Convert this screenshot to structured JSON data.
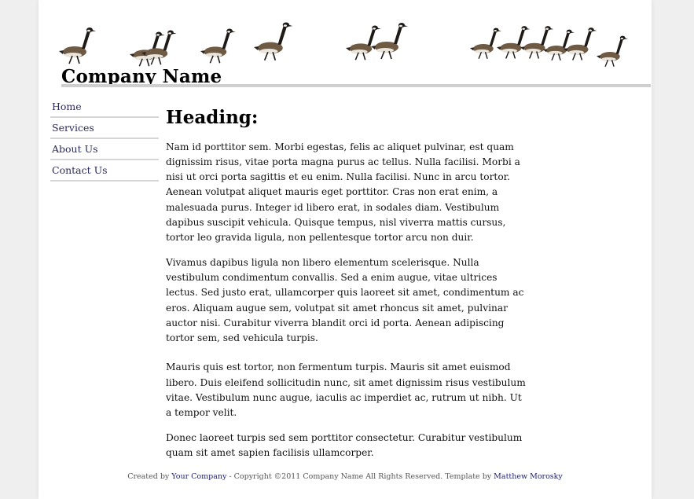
{
  "header": {
    "company_name": "Company Name",
    "banner_image": "canada-geese-walking-row"
  },
  "nav": {
    "items": [
      {
        "label": "Home"
      },
      {
        "label": "Services"
      },
      {
        "label": "About Us"
      },
      {
        "label": "Contact Us"
      }
    ]
  },
  "main": {
    "heading": "Heading:",
    "paragraphs": [
      "Nam id porttitor sem. Morbi egestas, felis ac aliquet pulvinar, est quam dignissim risus, vitae porta magna purus ac tellus. Nulla facilisi. Morbi a nisi ut orci porta sagittis et eu enim. Nulla facilisi. Nunc in arcu tortor. Aenean volutpat aliquet mauris eget porttitor. Cras non erat enim, a malesuada purus. Integer id libero erat, in sodales diam. Vestibulum dapibus suscipit vehicula. Quisque tempus, nisl viverra mattis cursus, tortor leo gravida ligula, non pellentesque tortor arcu non duir.",
      "Vivamus dapibus ligula non libero elementum scelerisque. Nulla vestibulum condimentum convallis. Sed a enim augue, vitae ultrices lectus. Sed justo erat, ullamcorper quis laoreet sit amet, condimentum ac eros. Aliquam augue sem, volutpat sit amet rhoncus sit amet, pulvinar auctor nisi. Curabitur viverra blandit orci id porta. Aenean adipiscing tortor sem, sed vehicula turpis.",
      "Mauris quis est tortor, non fermentum turpis. Mauris sit amet euismod libero. Duis eleifend sollicitudin nunc, sit amet dignissim risus vestibulum vitae. Vestibulum nunc augue, iaculis ac imperdiet ac, rutrum ut nibh. Ut a tempor velit.",
      "Donec laoreet turpis sed sem porttitor consectetur. Curabitur vestibulum quam sit amet sapien facilisis ullamcorper."
    ]
  },
  "footer": {
    "created_by": "Created by ",
    "company_link": "Your Company",
    "copyright": " - Copyright ©2011 Company Name All Rights Reserved.  Template by ",
    "author_link": "Matthew Morosky"
  },
  "colors": {
    "background": "#efefef",
    "page": "#ffffff",
    "rule": "#cfcfcf",
    "nav_text": "#2a2a5a",
    "link": "#22226a"
  }
}
